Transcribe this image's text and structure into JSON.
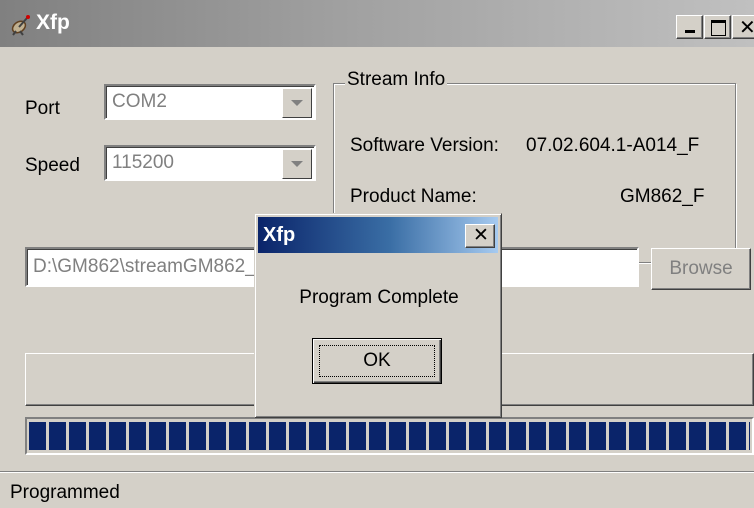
{
  "window": {
    "title": "Xfp",
    "app_icon": "satellite-dish-icon"
  },
  "connection": {
    "port_label": "Port",
    "port_value": "COM2",
    "speed_label": "Speed",
    "speed_value": "115200"
  },
  "stream_info": {
    "legend": "Stream Info",
    "software_version_label": "Software Version:",
    "software_version_value": "07.02.604.1-A014_F",
    "product_name_label": "Product Name:",
    "product_name_value": "GM862_F"
  },
  "file": {
    "path_value": "D:\\GM862\\streamGM862_F",
    "browse_label": "Browse"
  },
  "program": {
    "button_label": ""
  },
  "progress": {
    "fraction": 1.0,
    "fill_color": "#0a246a"
  },
  "status": {
    "text": "Programmed"
  },
  "dialog": {
    "title": "Xfp",
    "message": "Program Complete",
    "ok_label": "OK"
  }
}
